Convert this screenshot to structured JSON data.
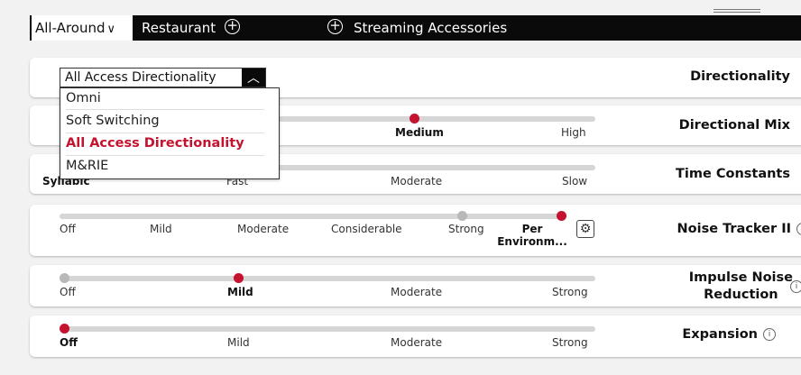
{
  "tabs": [
    {
      "label": "All-Around",
      "chevron": "∨",
      "active": true
    },
    {
      "label": "Restaurant",
      "icon": "plus-circle-icon"
    },
    {
      "label": "Streaming Accessories",
      "icon": "plus-circle-icon"
    }
  ],
  "accent_color": "#c4122f",
  "directionality": {
    "label": "Directionality",
    "selected": "All Access Directionality",
    "options": [
      "Omni",
      "Soft Switching",
      "All Access Directionality",
      "M&RIE"
    ]
  },
  "directional_mix": {
    "label": "Directional Mix",
    "ticks": [
      "Medium",
      "High"
    ],
    "selected": "Medium"
  },
  "time_constants": {
    "label": "Time Constants",
    "ticks": [
      "Syllabic",
      "Fast",
      "Moderate",
      "Slow"
    ],
    "selected": "Syllabic"
  },
  "noise_tracker": {
    "label": "Noise Tracker II",
    "ticks": [
      "Off",
      "Mild",
      "Moderate",
      "Considerable",
      "Strong",
      "Per Environm..."
    ],
    "selected": "Per Environm...",
    "secondary": "Strong"
  },
  "impulse_noise": {
    "label_line1": "Impulse Noise",
    "label_line2": "Reduction",
    "ticks": [
      "Off",
      "Mild",
      "Moderate",
      "Strong"
    ],
    "selected": "Mild",
    "secondary": "Off"
  },
  "expansion": {
    "label": "Expansion",
    "ticks": [
      "Off",
      "Mild",
      "Moderate",
      "Strong"
    ],
    "selected": "Off"
  }
}
